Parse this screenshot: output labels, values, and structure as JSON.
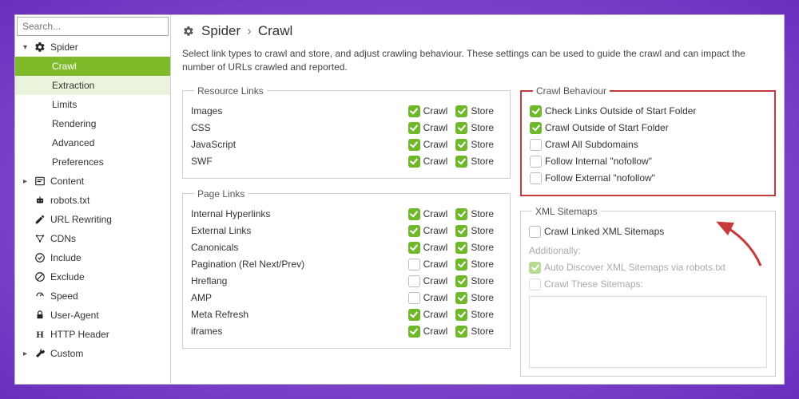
{
  "search": {
    "placeholder": "Search..."
  },
  "sidebar": {
    "spider": {
      "label": "Spider",
      "items": [
        {
          "label": "Crawl"
        },
        {
          "label": "Extraction"
        },
        {
          "label": "Limits"
        },
        {
          "label": "Rendering"
        },
        {
          "label": "Advanced"
        },
        {
          "label": "Preferences"
        }
      ]
    },
    "groups": [
      {
        "label": "Content"
      },
      {
        "label": "robots.txt"
      },
      {
        "label": "URL Rewriting"
      },
      {
        "label": "CDNs"
      },
      {
        "label": "Include"
      },
      {
        "label": "Exclude"
      },
      {
        "label": "Speed"
      },
      {
        "label": "User-Agent"
      },
      {
        "label": "HTTP Header"
      },
      {
        "label": "Custom"
      }
    ]
  },
  "header": {
    "crumb1": "Spider",
    "sep": "›",
    "crumb2": "Crawl",
    "desc": "Select link types to crawl and store, and adjust crawling behaviour. These settings can be used to guide the crawl and can impact the number of URLs crawled and reported."
  },
  "labels": {
    "crawl": "Crawl",
    "store": "Store"
  },
  "resource_links": {
    "legend": "Resource Links",
    "rows": [
      {
        "label": "Images",
        "crawl": true,
        "store": true
      },
      {
        "label": "CSS",
        "crawl": true,
        "store": true
      },
      {
        "label": "JavaScript",
        "crawl": true,
        "store": true
      },
      {
        "label": "SWF",
        "crawl": true,
        "store": true
      }
    ]
  },
  "page_links": {
    "legend": "Page Links",
    "rows": [
      {
        "label": "Internal Hyperlinks",
        "crawl": true,
        "store": true
      },
      {
        "label": "External Links",
        "crawl": true,
        "store": true
      },
      {
        "label": "Canonicals",
        "crawl": true,
        "store": true
      },
      {
        "label": "Pagination (Rel Next/Prev)",
        "crawl": false,
        "store": true
      },
      {
        "label": "Hreflang",
        "crawl": false,
        "store": true
      },
      {
        "label": "AMP",
        "crawl": false,
        "store": true
      },
      {
        "label": "Meta Refresh",
        "crawl": true,
        "store": true
      },
      {
        "label": "iframes",
        "crawl": true,
        "store": true
      }
    ]
  },
  "crawl_behaviour": {
    "legend": "Crawl Behaviour",
    "rows": [
      {
        "label": "Check Links Outside of Start Folder",
        "checked": true
      },
      {
        "label": "Crawl Outside of Start Folder",
        "checked": true
      },
      {
        "label": "Crawl All Subdomains",
        "checked": false
      },
      {
        "label": "Follow Internal \"nofollow\"",
        "checked": false
      },
      {
        "label": "Follow External \"nofollow\"",
        "checked": false
      }
    ]
  },
  "xml_sitemaps": {
    "legend": "XML Sitemaps",
    "main": {
      "label": "Crawl Linked XML Sitemaps",
      "checked": false
    },
    "additionally": "Additionally:",
    "auto": {
      "label": "Auto Discover XML Sitemaps via robots.txt",
      "checked": true,
      "disabled": true
    },
    "these": {
      "label": "Crawl These Sitemaps:",
      "checked": false,
      "disabled": true
    }
  }
}
